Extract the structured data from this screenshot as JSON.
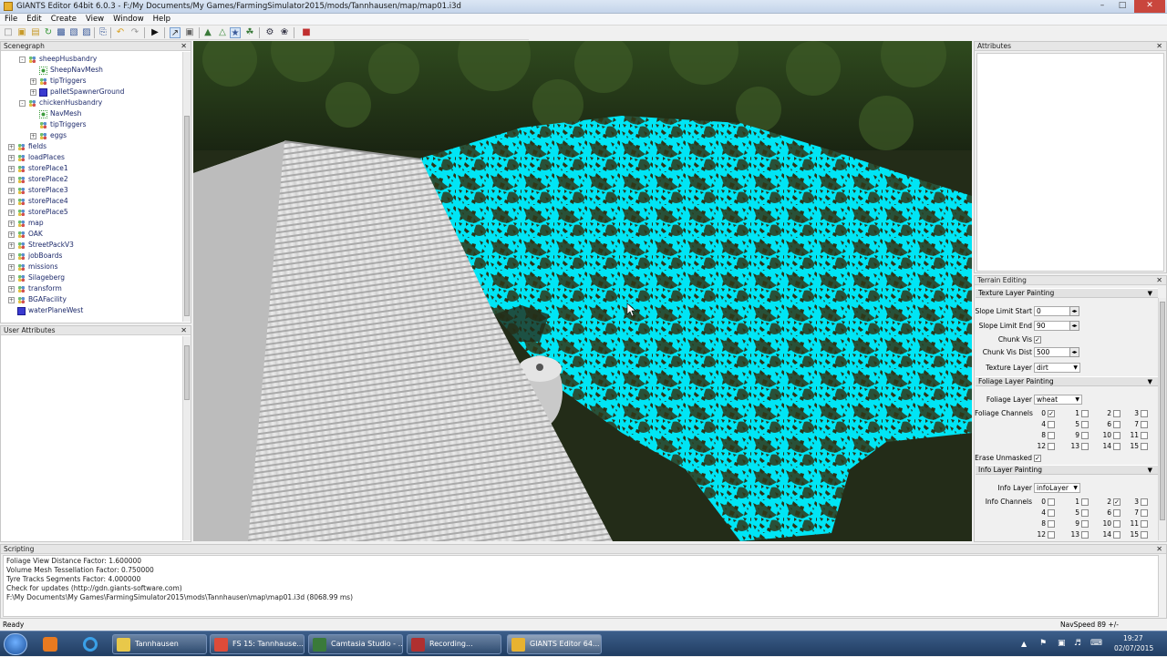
{
  "window": {
    "title": "GIANTS Editor 64bit 6.0.3 - F:/My Documents/My Games/FarmingSimulator2015/mods/Tannhausen/map/map01.i3d"
  },
  "menu": [
    "File",
    "Edit",
    "Create",
    "View",
    "Window",
    "Help"
  ],
  "scenegraph": {
    "title": "Scenegraph",
    "items": [
      {
        "label": "sheepHusbandry",
        "icon": "transform-group-icon",
        "expand": "-"
      },
      {
        "label": "SheepNavMesh",
        "icon": "navmesh-icon",
        "expand": ""
      },
      {
        "label": "tipTriggers",
        "icon": "transform-group-icon",
        "expand": "+"
      },
      {
        "label": "palletSpawnerGround",
        "icon": "shape-icon",
        "expand": "+"
      },
      {
        "label": "chickenHusbandry",
        "icon": "transform-group-icon",
        "expand": "-"
      },
      {
        "label": "NavMesh",
        "icon": "navmesh-icon",
        "expand": ""
      },
      {
        "label": "tipTriggers",
        "icon": "transform-group-icon",
        "expand": ""
      },
      {
        "label": "eggs",
        "icon": "transform-group-icon",
        "expand": "+"
      },
      {
        "label": "fields",
        "icon": "transform-group-icon",
        "expand": "+"
      },
      {
        "label": "loadPlaces",
        "icon": "transform-group-icon",
        "expand": "+"
      },
      {
        "label": "storePlace1",
        "icon": "transform-group-icon",
        "expand": "+"
      },
      {
        "label": "storePlace2",
        "icon": "transform-group-icon",
        "expand": "+"
      },
      {
        "label": "storePlace3",
        "icon": "transform-group-icon",
        "expand": "+"
      },
      {
        "label": "storePlace4",
        "icon": "transform-group-icon",
        "expand": "+"
      },
      {
        "label": "storePlace5",
        "icon": "transform-group-icon",
        "expand": "+"
      },
      {
        "label": "map",
        "icon": "transform-group-icon",
        "expand": "+"
      },
      {
        "label": "OAK",
        "icon": "transform-group-icon",
        "expand": "+"
      },
      {
        "label": "StreetPackV3",
        "icon": "transform-group-icon",
        "expand": "+"
      },
      {
        "label": "jobBoards",
        "icon": "transform-group-icon",
        "expand": "+"
      },
      {
        "label": "missions",
        "icon": "transform-group-icon",
        "expand": "+"
      },
      {
        "label": "Silageberg",
        "icon": "transform-group-icon",
        "expand": "+"
      },
      {
        "label": "transform",
        "icon": "transform-group-icon",
        "expand": "+"
      },
      {
        "label": "BGAFacility",
        "icon": "transform-group-icon",
        "expand": "+"
      },
      {
        "label": "waterPlaneWest",
        "icon": "shape-icon",
        "expand": ""
      }
    ]
  },
  "user_attributes": {
    "title": "User Attributes"
  },
  "attributes": {
    "title": "Attributes"
  },
  "terrain": {
    "title": "Terrain Editing",
    "texture_section": "Texture Layer Painting",
    "slope_start_label": "Slope Limit Start",
    "slope_start_value": "0",
    "slope_end_label": "Slope Limit End",
    "slope_end_value": "90",
    "chunk_vis_label": "Chunk Vis",
    "chunk_vis_dist_label": "Chunk Vis Dist",
    "chunk_vis_dist_value": "500",
    "texture_layer_label": "Texture Layer",
    "texture_layer_value": "dirt",
    "foliage_section": "Foliage Layer Painting",
    "foliage_layer_label": "Foliage Layer",
    "foliage_layer_value": "wheat",
    "foliage_channels_label": "Foliage Channels",
    "foliage_channels": [
      {
        "n": "0",
        "checked": true
      },
      {
        "n": "1",
        "checked": false
      },
      {
        "n": "2",
        "checked": false
      },
      {
        "n": "3",
        "checked": false
      },
      {
        "n": "4",
        "checked": false
      },
      {
        "n": "5",
        "checked": false
      },
      {
        "n": "6",
        "checked": false
      },
      {
        "n": "7",
        "checked": false
      },
      {
        "n": "8",
        "checked": false
      },
      {
        "n": "9",
        "checked": false
      },
      {
        "n": "10",
        "checked": false
      },
      {
        "n": "11",
        "checked": false
      },
      {
        "n": "12",
        "checked": false
      },
      {
        "n": "13",
        "checked": false
      },
      {
        "n": "14",
        "checked": false
      },
      {
        "n": "15",
        "checked": false
      }
    ],
    "erase_unmasked_label": "Erase Unmasked",
    "info_section": "Info Layer Painting",
    "info_layer_label": "Info Layer",
    "info_layer_value": "infoLayer",
    "info_channels_label": "Info Channels",
    "info_channels": [
      {
        "n": "0",
        "checked": false
      },
      {
        "n": "1",
        "checked": false
      },
      {
        "n": "2",
        "checked": true
      },
      {
        "n": "3",
        "checked": false
      },
      {
        "n": "4",
        "checked": false
      },
      {
        "n": "5",
        "checked": false
      },
      {
        "n": "6",
        "checked": false
      },
      {
        "n": "7",
        "checked": false
      },
      {
        "n": "8",
        "checked": false
      },
      {
        "n": "9",
        "checked": false
      },
      {
        "n": "10",
        "checked": false
      },
      {
        "n": "11",
        "checked": false
      },
      {
        "n": "12",
        "checked": false
      },
      {
        "n": "13",
        "checked": false
      },
      {
        "n": "14",
        "checked": false
      },
      {
        "n": "15",
        "checked": false
      }
    ]
  },
  "scripting": {
    "title": "Scripting",
    "lines": [
      "  Foliage View Distance Factor: 1.600000",
      "  Volume Mesh Tessellation Factor: 0.750000",
      "  Tyre Tracks Segments Factor: 4.000000",
      "Check for updates (http://gdn.giants-software.com)",
      "F:\\My Documents\\My Games\\FarmingSimulator2015\\mods\\Tannhausen\\map\\map01.i3d (8068.99 ms)"
    ]
  },
  "status": {
    "left": "Ready",
    "right": "NavSpeed 89 +/-"
  },
  "taskbar": {
    "tasks": [
      {
        "label": "Tannhausen",
        "color": "#e8c84a",
        "icon": "folder-icon"
      },
      {
        "label": "FS 15: Tannhause...",
        "color": "#dd4b39",
        "icon": "chrome-icon"
      },
      {
        "label": "Camtasia Studio - ...",
        "color": "#3a7a3a",
        "icon": "camtasia-icon"
      },
      {
        "label": "Recording...",
        "color": "#b03030",
        "icon": "recording-icon"
      },
      {
        "label": "GIANTS Editor 64...",
        "color": "#e8b230",
        "icon": "giants-icon"
      }
    ],
    "time": "19:27",
    "date": "02/07/2015"
  },
  "colors": {
    "paint_overlay": "#00e5f5",
    "selection": "#cde0f5"
  }
}
